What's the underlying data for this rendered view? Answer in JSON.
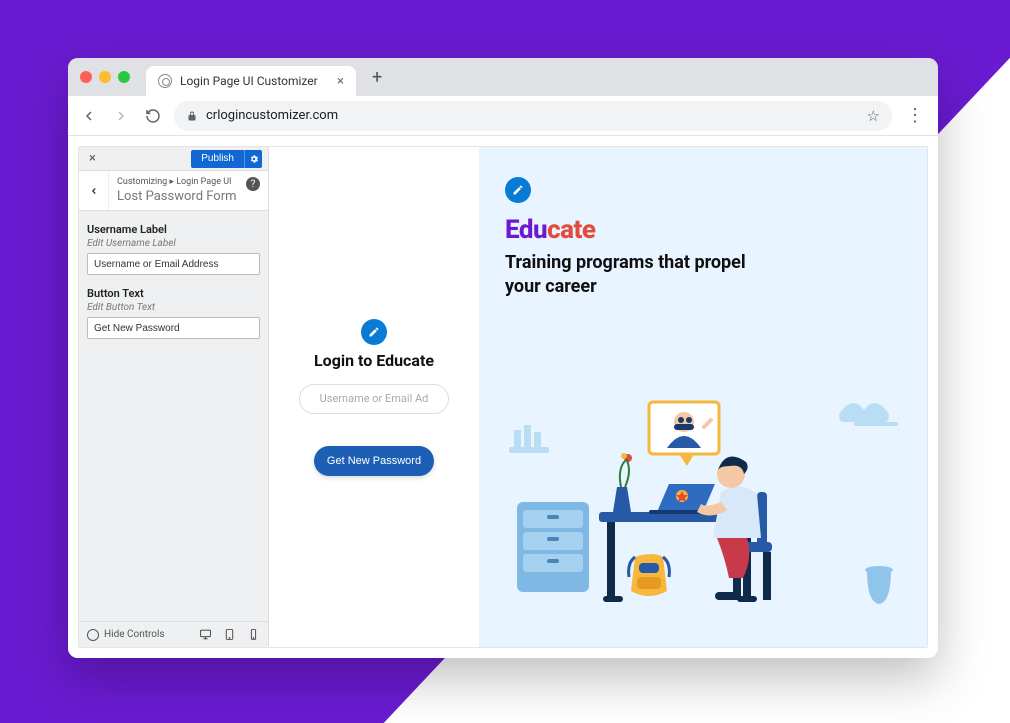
{
  "browser": {
    "tab_title": "Login Page UI Customizer",
    "url": "crlogincustomizer.com"
  },
  "customizer": {
    "publish_label": "Publish",
    "breadcrumb_prefix": "Customizing",
    "breadcrumb_section": "Login Page UI",
    "breadcrumb_title": "Lost Password Form",
    "controls": {
      "username_label_title": "Username Label",
      "username_label_hint": "Edit Username Label",
      "username_label_value": "Username or Email Address",
      "button_text_title": "Button Text",
      "button_text_hint": "Edit Button Text",
      "button_text_value": "Get New Password"
    },
    "footer": {
      "hide_controls": "Hide Controls"
    }
  },
  "preview": {
    "login_heading": "Login to Educate",
    "login_placeholder": "Username or Email Ad",
    "login_button": "Get New Password",
    "brand_part1": "Edu",
    "brand_part2": "cate",
    "tagline": "Training programs that propel your career"
  },
  "colors": {
    "accent_purple": "#6a1bd1",
    "accent_orange": "#e34b3a",
    "primary_blue": "#1268d3",
    "button_blue": "#1d5fb5",
    "preview_bg": "#e8f4ff"
  }
}
